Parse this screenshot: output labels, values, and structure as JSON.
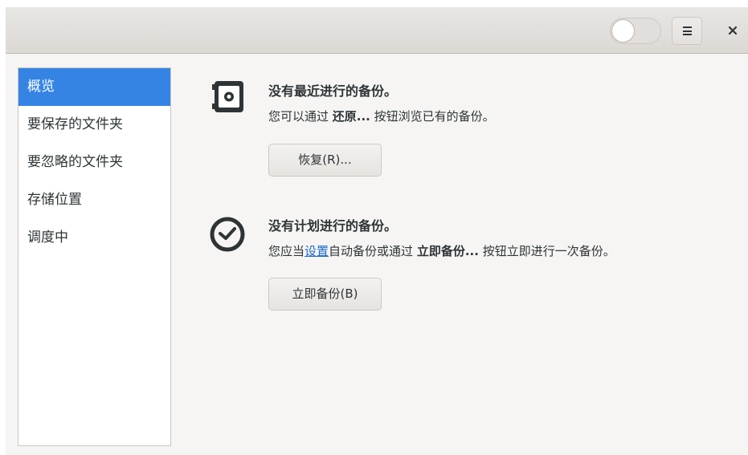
{
  "header": {
    "switch_state": "off",
    "menu_icon": "open-menu-icon",
    "close_glyph": "×"
  },
  "sidebar": {
    "items": [
      {
        "label": "概览",
        "selected": true
      },
      {
        "label": "要保存的文件夹",
        "selected": false
      },
      {
        "label": "要忽略的文件夹",
        "selected": false
      },
      {
        "label": "存储位置",
        "selected": false
      },
      {
        "label": "调度中",
        "selected": false
      }
    ]
  },
  "main": {
    "restore_section": {
      "icon": "safe-icon",
      "title": "没有最近进行的备份。",
      "desc_prefix": "您可以通过 ",
      "desc_bold": "还原...",
      "desc_suffix": " 按钮浏览已有的备份。",
      "button_label": "恢复(R)..."
    },
    "schedule_section": {
      "icon": "clock-icon",
      "title": "没有计划进行的备份。",
      "desc_prefix": "您应当",
      "desc_link": "设置",
      "desc_middle": "自动备份或通过 ",
      "desc_bold": "立即备份...",
      "desc_suffix": " 按钮立即进行一次备份。",
      "button_label": "立即备份(B)"
    }
  },
  "colors": {
    "accent": "#3584e4",
    "link": "#1b6acb",
    "window_bg": "#f6f5f4",
    "headerbar_bg": "#dcd9d5"
  }
}
